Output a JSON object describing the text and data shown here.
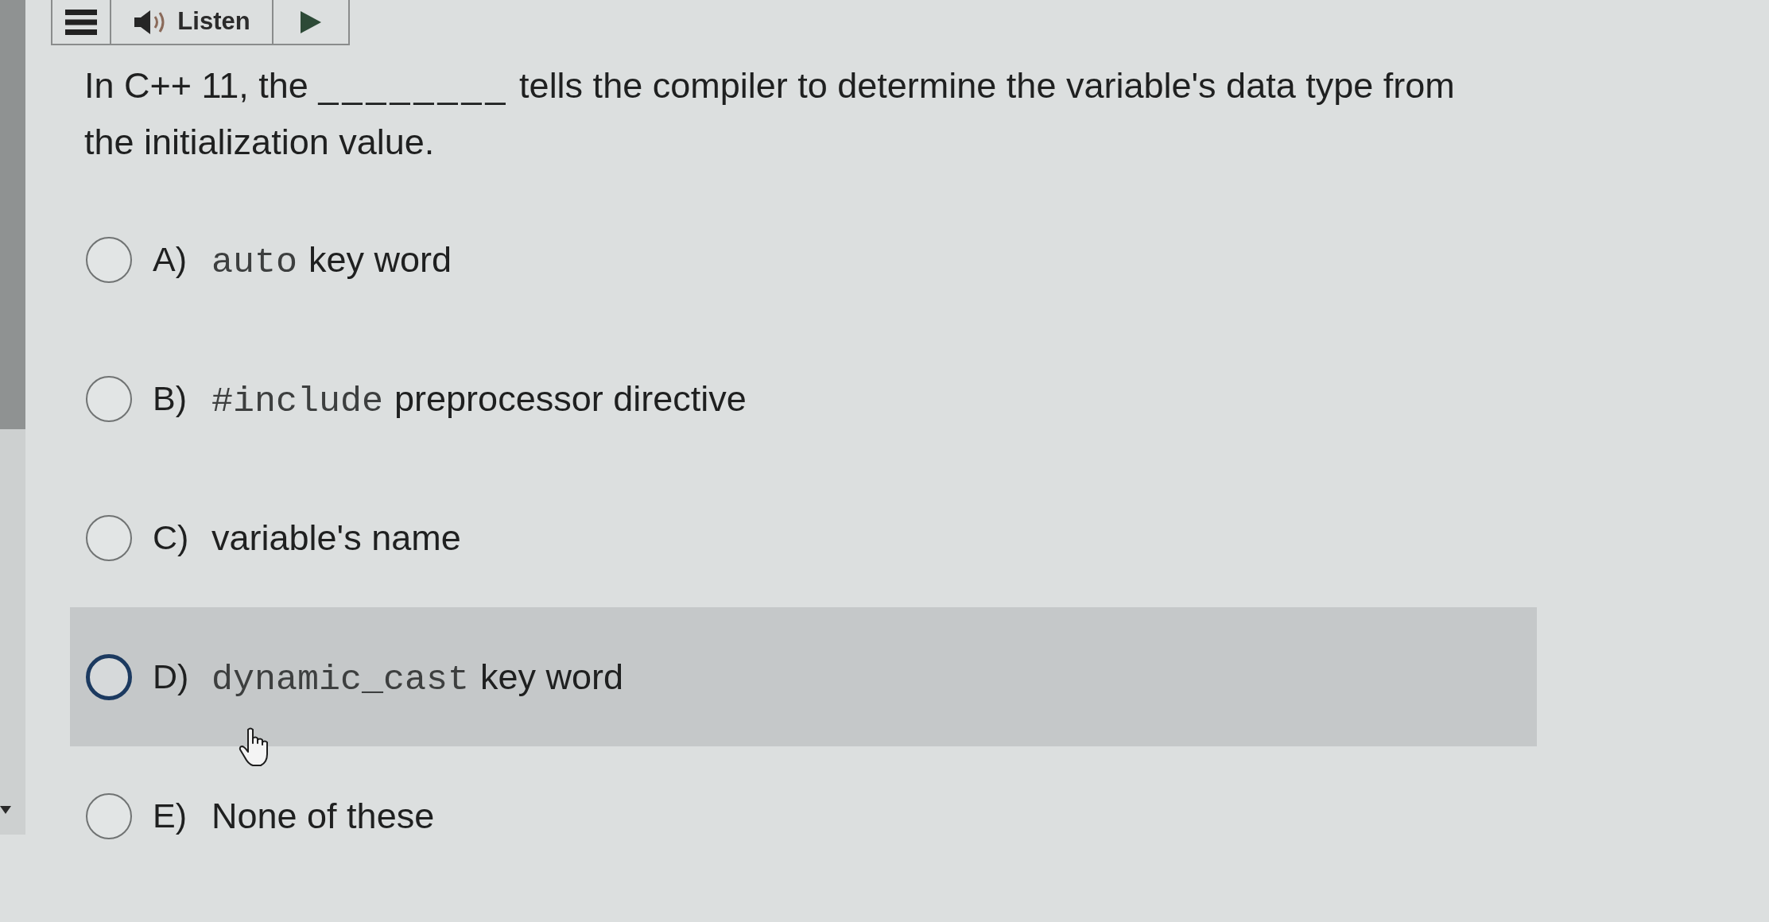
{
  "toolbar": {
    "listen_label": "Listen"
  },
  "question": {
    "before": "In C++ 11, the",
    "blank": "________",
    "after": "tells the compiler to determine the variable's data type from the initialization value."
  },
  "options": [
    {
      "letter": "A)",
      "code": "auto",
      "text": "key word",
      "selected": false,
      "hovered": false
    },
    {
      "letter": "B)",
      "code": "#include",
      "text": "preprocessor directive",
      "selected": false,
      "hovered": false
    },
    {
      "letter": "C)",
      "text": "variable's name",
      "selected": false,
      "hovered": false
    },
    {
      "letter": "D)",
      "code": "dynamic_cast",
      "text": "key word",
      "selected": false,
      "hovered": true
    },
    {
      "letter": "E)",
      "text": "None of these",
      "selected": false,
      "hovered": false
    }
  ]
}
